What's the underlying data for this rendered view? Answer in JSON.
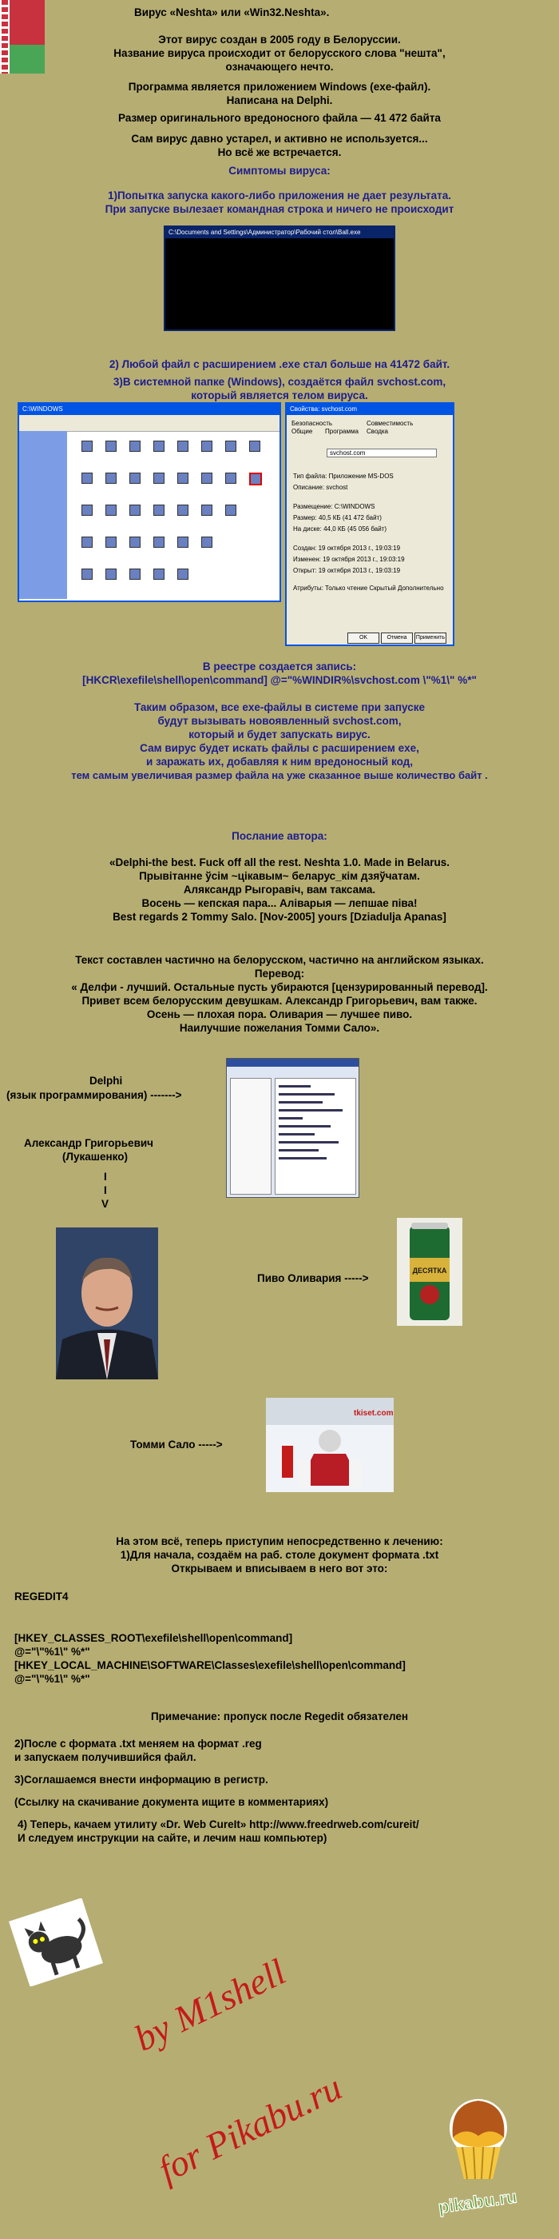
{
  "intro": [
    "Вирус «Neshta» или «Win32.Neshta».",
    "Этот вирус создан в 2005 году в Белоруссии.",
    "Название вируса происходит от белорусского слова \"нешта\",",
    "означающего нечто.",
    "Программа является приложением Windows (exe-файл).",
    "Написана на Delphi.",
    "Размер оригинального вредоносного файла — 41 472 байта",
    "Сам вирус давно устарел, и активно не используется...",
    "Но всё же встречается."
  ],
  "symptoms_heading": "Симптомы вируса:",
  "symptom1": [
    "1)Попытка запуска какого-либо приложения не дает результата.",
    "При запуске вылезает командная строка и ничего не происходит"
  ],
  "cmd_title": "C:\\Documents and Settings\\Администратор\\Рабочий стол\\Ball.exe",
  "symptom2": "2) Любой файл с расширением .exe стал больше на 41472 байт.",
  "symptom3": [
    "3)В системной папке (Windows), создаётся файл svchost.com,",
    "который является телом вируса."
  ],
  "explorer_title": "C:\\WINDOWS",
  "props": {
    "title": "Свойства: svchost.com",
    "tabs": [
      "Общие",
      "Программа",
      "Безопасность",
      "Сводка",
      "Совместимость"
    ],
    "filename": "svchost.com",
    "rows": [
      "Тип файла:   Приложение MS-DOS",
      "Описание:   svchost",
      "Размещение:   C:\\WINDOWS",
      "Размер:   40,5 КБ (41 472 байт)",
      "На диске:   44,0 КБ (45 056 байт)",
      "Создан:   19 октября 2013 г., 19:03:19",
      "Изменен:   19 октября 2013 г., 19:03:19",
      "Открыт:   19 октября 2013 г., 19:03:19",
      "Атрибуты:   Только чтение   Скрытый   Дополнительно"
    ],
    "ok": "OK",
    "cancel": "Отмена",
    "apply": "Применить"
  },
  "registry": [
    "В реестре создается запись:",
    "[HKCR\\exefile\\shell\\open\\command] @=\"%WINDIR%\\svchost.com \\\"%1\\\" %*\""
  ],
  "explain": [
    "Таким образом, все exe-файлы в системе при запуске",
    "будут вызывать новоявленный svchost.com,",
    "который и будет запускать вирус.",
    "Сам вирус будет искать файлы с расширением exe,",
    "и заражать их, добавляя к ним вредоносный код,",
    "тем самым увеличивая размер файла на уже сказанное выше количество байт ."
  ],
  "author_heading": "Послание автора:",
  "message": [
    "«Delphi-the best. Fuck off all the rest. Neshta 1.0. Made in Belarus.",
    "Прывітанне ўсім ~цікавым~ беларус_кім дзяўчатам.",
    "Аляксандр Рыгоравіч, вам таксама.",
    "Восень — кепская пара... Аліварыя — лепшае піва!",
    "Best regards 2 Tommy Salo. [Nov-2005] yours [Dziadulja Apanas]"
  ],
  "translation": [
    "Текст составлен частично на белорусском, частично на английском языках.",
    "Перевод:",
    "« Делфи - лучший. Остальные пусть убираются [цензурированный перевод].",
    "Привет всем белорусским девушкам. Александр Григорьевич, вам также.",
    "Осень — плохая пора. Оливария — лучшее пиво.",
    "Наилучшие пожелания Томми Сало»."
  ],
  "captions": {
    "delphi": [
      "Delphi",
      "(язык программирования) ------->"
    ],
    "luk": [
      "Александр Григорьевич",
      "(Лукашенко)",
      "I",
      "I",
      "V"
    ],
    "beer": "Пиво Оливария ----->",
    "tommy": "Томми Сало ----->"
  },
  "beer_label": "ДЕСЯТКА",
  "hockey_sign": "tkiset.com",
  "treatment": [
    "На этом всё, теперь приступим непосредственно к лечению:",
    "1)Для начала, создаём на раб. столе документ формата .txt",
    "Открываем и вписываем в него вот это:"
  ],
  "regedit": [
    "REGEDIT4",
    "[HKEY_CLASSES_ROOT\\exefile\\shell\\open\\command]",
    "@=\"\\\"%1\\\" %*\"",
    "[HKEY_LOCAL_MACHINE\\SOFTWARE\\Classes\\exefile\\shell\\open\\command]",
    "@=\"\\\"%1\\\" %*\""
  ],
  "note": "Примечание: пропуск после Regedit обязателен",
  "steps": [
    "2)После с формата .txt меняем на формат .reg",
    "и запускаем получившийся файл.",
    "3)Соглашаемся внести информацию в регистр.",
    "(Ссылку на скачивание документа ищите в комментариях)",
    "4) Теперь, качаем утилиту «Dr. Web CureIt»        http://www.freedrweb.com/cureit/",
    "И следуем инструкции на сайте, и лечим наш компьютер)"
  ],
  "signature": [
    "by M1shell",
    "for Pikabu.ru"
  ],
  "pikabu_logo": "pikabu.ru",
  "colors": {
    "background": "#b6ad73",
    "heading_blue": "#1d1d8c",
    "signature_red": "#c41a1a"
  }
}
